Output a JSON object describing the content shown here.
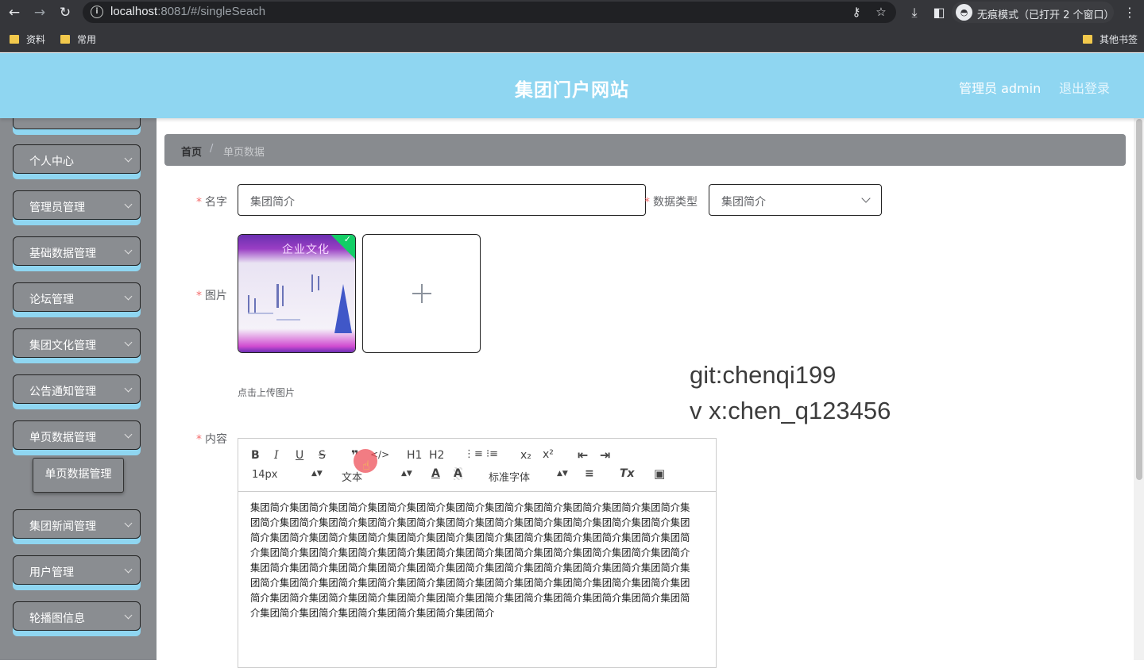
{
  "browser": {
    "url_host": "localhost",
    "url_rest": ":8081/#/singleSeach",
    "incognito_label": "无痕模式（已打开 2 个窗口）",
    "bookmarks": [
      "资料",
      "常用"
    ],
    "other_bookmarks": "其他书签"
  },
  "header": {
    "title": "集团门户网站",
    "admin": "管理员 admin",
    "logout": "退出登录"
  },
  "sidebar": {
    "items": [
      {
        "label": "个人中心"
      },
      {
        "label": "管理员管理"
      },
      {
        "label": "基础数据管理"
      },
      {
        "label": "论坛管理"
      },
      {
        "label": "集团文化管理"
      },
      {
        "label": "公告通知管理"
      },
      {
        "label": "单页数据管理"
      },
      {
        "label": "集团新闻管理"
      },
      {
        "label": "用户管理"
      },
      {
        "label": "轮播图信息"
      }
    ],
    "submenu": "单页数据管理"
  },
  "breadcrumb": {
    "home": "首页",
    "separator": "/",
    "current": "单页数据"
  },
  "form": {
    "name_label": "名字",
    "name_value": "集团简介",
    "type_label": "数据类型",
    "type_value": "集团简介",
    "picture_label": "图片",
    "upload_tip": "点击上传图片",
    "content_label": "内容",
    "required_mark": "*"
  },
  "thumbnail": {
    "title": "企业文化"
  },
  "editor": {
    "toolbar": {
      "bold": "B",
      "italic": "I",
      "underline": "U",
      "strike": "S",
      "blockquote": "❞",
      "code": "</>",
      "h1": "H1",
      "h2": "H2",
      "ordered_list": "⋮≡",
      "bullet_list": "⁝≡",
      "subscript": "x₂",
      "superscript": "x²",
      "outdent": "⇤",
      "indent": "⇥",
      "size": "14px",
      "header": "文本",
      "color": "A",
      "background": "A",
      "font": "标准字体",
      "align": "≡",
      "clean": "Tx",
      "image": "▣"
    },
    "content": "集团简介集团简介集团简介集团简介集团简介集团简介集团简介集团简介集团简介集团简介集团简介集团简介集团简介集团简介集团简介集团简介集团简介集团简介集团简介集团简介集团简介集团简介集团简介集团简介集团简介集团简介集团简介集团简介集团简介集团简介集团简介集团简介集团简介集团简介集团简介集团简介集团简介集团简介集团简介集团简介集团简介集团简介集团简介集团简介集团简介集团简介集团简介集团简介集团简介集团简介集团简介集团简介集团简介集团简介集团简介集团简介集团简介集团简介集团简介集团简介集团简介集团简介集团简介集团简介集团简介集团简介集团简介集团简介集团简介集团简介集团简介集团简介集团简介集团简介集团简介集团简介集团简介集团简介集团简介集团简介集团简介集团简介集团简介集团简介集团简介"
  },
  "watermark": {
    "line1": "git:chenqi199",
    "line2": "v x:chen_q123456"
  },
  "icons": {
    "back": "arrow-left-icon",
    "forward": "arrow-right-icon",
    "reload": "reload-icon",
    "key": "key-icon",
    "star": "star-icon",
    "download": "download-icon",
    "sidepanel": "side-panel-icon",
    "more": "more-vert-icon"
  },
  "colors": {
    "header_bg": "#8fd6f1",
    "sidebar_bg": "#888b8f",
    "menu_shadow": "#8fd6f1",
    "required": "#f56c6c",
    "success": "#13ce66"
  }
}
